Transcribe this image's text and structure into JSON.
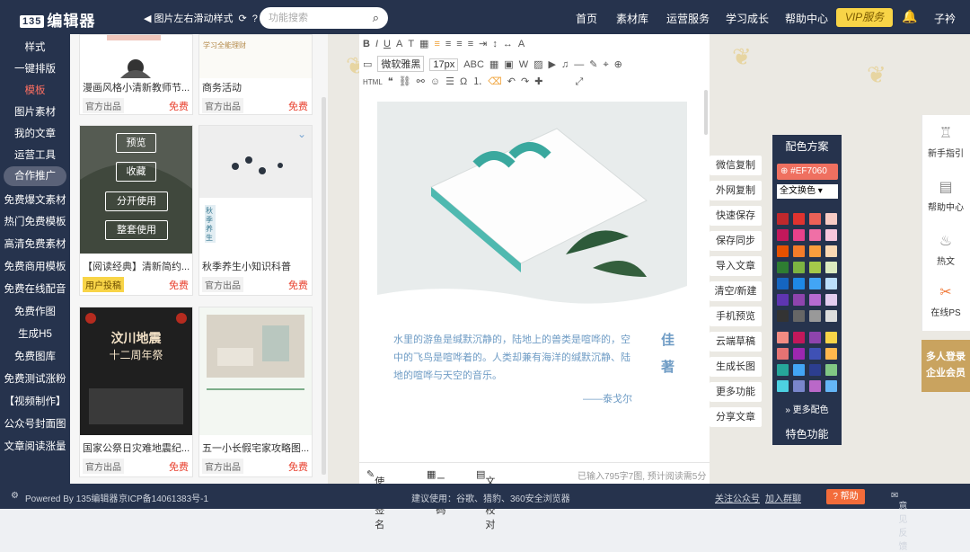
{
  "topbar": {
    "logo_mark": "135",
    "logo_text": "编辑器",
    "tip": "图片左右滑动样式",
    "search_placeholder": "功能搜索",
    "nav": [
      "首页",
      "素材库",
      "运营服务",
      "学习成长",
      "帮助中心"
    ],
    "vip": "VIP服务",
    "user": "子衿"
  },
  "leftnav": {
    "items": [
      "样式",
      "一键排版",
      "模板",
      "图片素材",
      "我的文章",
      "运营工具",
      "合作推广",
      "免费爆文素材",
      "热门免费模板",
      "高清免费素材",
      "免费商用模板",
      "免费在线配音",
      "免费作图",
      "生成H5",
      "免费图库",
      "免费测试涨粉",
      "【视频制作】",
      "公众号封面图",
      "文章阅读涨量"
    ],
    "active": "模板",
    "highlighted": "合作推广"
  },
  "templates": {
    "cards": [
      {
        "title": "漫画风格小清新教师节...",
        "badge": "官方出品",
        "price": "免费",
        "thumb_text": "学习全能理财"
      },
      {
        "title": "商务活动",
        "badge": "官方出品",
        "price": "免费"
      },
      {
        "title": "【阅读经典】清新简约...",
        "badge": "用户投稿",
        "price": "免费"
      },
      {
        "title": "秋季养生小知识科普",
        "badge": "官方出品",
        "price": "免费",
        "thumb_text": "秋季养生"
      },
      {
        "title": "国家公祭日灾难地震纪...",
        "badge": "官方出品",
        "price": "免费",
        "thumb_line1": "汶川地震",
        "thumb_line2": "十二周年祭"
      },
      {
        "title": "五一小长假宅家攻略图...",
        "badge": "官方出品",
        "price": "免费"
      }
    ],
    "overlay_buttons": [
      "预览",
      "收藏",
      "分开使用",
      "整套使用"
    ]
  },
  "editor": {
    "font": "微软雅黑",
    "size": "17px",
    "poem": "水里的游鱼是缄默沉静的，陆地上的兽类是喧哗的，空中的飞鸟是喧哗着的。人类却兼有海洋的缄默沉静、陆地的喧哗与天空的音乐。",
    "poem_author": "——泰戈尔",
    "side_title": "佳著",
    "footer": {
      "sign": "使用签名",
      "qr": "二维码",
      "check": "文本校对",
      "status": "已输入795字7图, 预计阅读需5分钟"
    }
  },
  "actions": [
    "微信复制",
    "外网复制",
    "快速保存",
    "保存同步",
    "导入文章",
    "清空/新建",
    "手机预览",
    "云端草稿",
    "生成长图",
    "更多功能",
    "分享文章"
  ],
  "palette": {
    "title": "配色方案",
    "hex": "#EF7060",
    "select": "全文换色",
    "more": "更多配色",
    "feature": "特色功能",
    "colors": [
      [
        "#c0282c",
        "#e0332f",
        "#ec6157",
        "#f7cbc4"
      ],
      [
        "#c2185b",
        "#e8418b",
        "#f06fa6",
        "#f7c6dc"
      ],
      [
        "#e65100",
        "#f57c2a",
        "#fa9e3d",
        "#fbd9b4"
      ],
      [
        "#2e7d32",
        "#7cb342",
        "#a5c94a",
        "#dcebc0"
      ],
      [
        "#1565c0",
        "#1e88e5",
        "#42a5f5",
        "#bbdefb"
      ],
      [
        "#5e35b1",
        "#8e44ad",
        "#b76bd1",
        "#e3cdef"
      ],
      [
        "#333333",
        "#666666",
        "#999999",
        "#dddddd"
      ],
      [
        "#f28b82",
        "#c2185b",
        "#8e44ad",
        "#f8d447"
      ],
      [
        "#e57373",
        "#9c27b0",
        "#3f51b5",
        "#ffb74d"
      ],
      [
        "#26a69a",
        "#42a5f5",
        "#2c3e8f",
        "#81c784"
      ],
      [
        "#4dd0e1",
        "#7986cb",
        "#ba68c8",
        "#64b5f6"
      ]
    ]
  },
  "rightrail": [
    "新手指引",
    "帮助中心",
    "热文",
    "在线PS"
  ],
  "promo": [
    "多人登录",
    "企业会员"
  ],
  "bottom": {
    "powered": "Powered By 135编辑器",
    "icp": "京ICP备14061383号-1",
    "browser": "建议使用：谷歌、猎豹、360安全浏览器",
    "follow": "关注公众号",
    "group": "加入群聊",
    "help": "帮助",
    "feedback": "意见反馈"
  }
}
